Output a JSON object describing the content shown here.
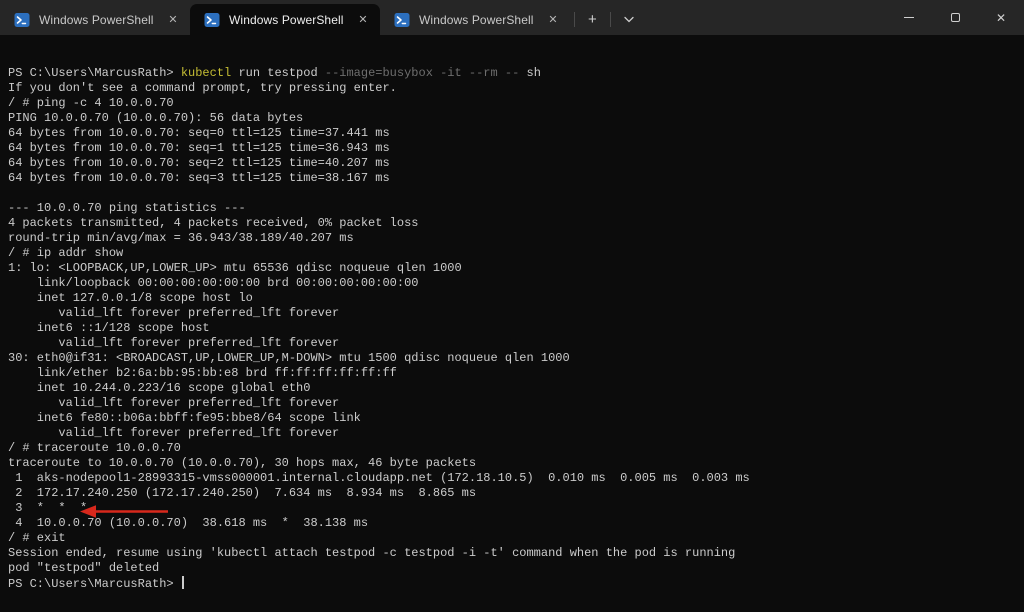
{
  "window": {
    "tabs": [
      {
        "label": "Windows PowerShell"
      },
      {
        "label": "Windows PowerShell"
      },
      {
        "label": "Windows PowerShell"
      }
    ],
    "tab_close_glyph": "✕",
    "new_tab_glyph": "+",
    "controls": {
      "minimize": "minimize",
      "maximize": "maximize",
      "close": "✕"
    }
  },
  "terminal": {
    "colors": {
      "background": "#0c0c0c",
      "foreground": "#cccccc",
      "command_yellow": "#c5bd34",
      "parameter_gray": "#6e6e6e"
    },
    "lines": [
      {
        "segs": [
          {
            "t": "PS C:\\Users\\MarcusRath> ",
            "c": "fg"
          },
          {
            "t": "kubectl",
            "c": "cmd"
          },
          {
            "t": " run testpod ",
            "c": "fg"
          },
          {
            "t": "--image=busybox -it --rm --",
            "c": "dim"
          },
          {
            "t": " sh",
            "c": "fg"
          }
        ]
      },
      {
        "t": "If you don't see a command prompt, try pressing enter."
      },
      {
        "t": "/ # ping -c 4 10.0.0.70"
      },
      {
        "t": "PING 10.0.0.70 (10.0.0.70): 56 data bytes"
      },
      {
        "t": "64 bytes from 10.0.0.70: seq=0 ttl=125 time=37.441 ms"
      },
      {
        "t": "64 bytes from 10.0.0.70: seq=1 ttl=125 time=36.943 ms"
      },
      {
        "t": "64 bytes from 10.0.0.70: seq=2 ttl=125 time=40.207 ms"
      },
      {
        "t": "64 bytes from 10.0.0.70: seq=3 ttl=125 time=38.167 ms"
      },
      {
        "t": ""
      },
      {
        "t": "--- 10.0.0.70 ping statistics ---"
      },
      {
        "t": "4 packets transmitted, 4 packets received, 0% packet loss"
      },
      {
        "t": "round-trip min/avg/max = 36.943/38.189/40.207 ms"
      },
      {
        "t": "/ # ip addr show"
      },
      {
        "t": "1: lo: <LOOPBACK,UP,LOWER_UP> mtu 65536 qdisc noqueue qlen 1000"
      },
      {
        "t": "    link/loopback 00:00:00:00:00:00 brd 00:00:00:00:00:00"
      },
      {
        "t": "    inet 127.0.0.1/8 scope host lo"
      },
      {
        "t": "       valid_lft forever preferred_lft forever"
      },
      {
        "t": "    inet6 ::1/128 scope host"
      },
      {
        "t": "       valid_lft forever preferred_lft forever"
      },
      {
        "t": "30: eth0@if31: <BROADCAST,UP,LOWER_UP,M-DOWN> mtu 1500 qdisc noqueue qlen 1000"
      },
      {
        "t": "    link/ether b2:6a:bb:95:bb:e8 brd ff:ff:ff:ff:ff:ff"
      },
      {
        "t": "    inet 10.244.0.223/16 scope global eth0"
      },
      {
        "t": "       valid_lft forever preferred_lft forever"
      },
      {
        "t": "    inet6 fe80::b06a:bbff:fe95:bbe8/64 scope link"
      },
      {
        "t": "       valid_lft forever preferred_lft forever"
      },
      {
        "t": "/ # traceroute 10.0.0.70"
      },
      {
        "t": "traceroute to 10.0.0.70 (10.0.0.70), 30 hops max, 46 byte packets"
      },
      {
        "t": " 1  aks-nodepool1-28993315-vmss000001.internal.cloudapp.net (172.18.10.5)  0.010 ms  0.005 ms  0.003 ms"
      },
      {
        "t": " 2  172.17.240.250 (172.17.240.250)  7.634 ms  8.934 ms  8.865 ms"
      },
      {
        "t": " 3  *  *  *"
      },
      {
        "t": " 4  10.0.0.70 (10.0.0.70)  38.618 ms  *  38.138 ms"
      },
      {
        "t": "/ # exit"
      },
      {
        "t": "Session ended, resume using 'kubectl attach testpod -c testpod -i -t' command when the pod is running"
      },
      {
        "t": "pod \"testpod\" deleted"
      },
      {
        "segs": [
          {
            "t": "PS C:\\Users\\MarcusRath> ",
            "c": "fg"
          }
        ],
        "cursor": true
      }
    ]
  },
  "annotation": {
    "type": "arrow-pointing-left",
    "color": "#d8281c",
    "target_text": "exit"
  }
}
